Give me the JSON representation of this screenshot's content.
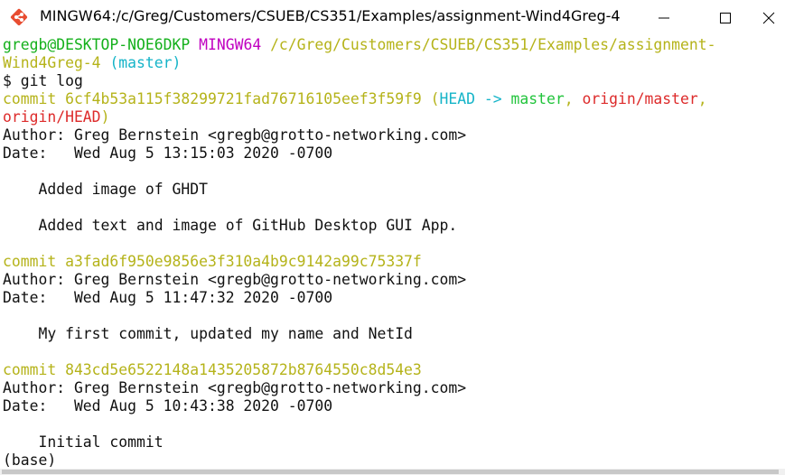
{
  "window": {
    "title": "MINGW64:/c/Greg/Customers/CSUEB/CS351/Examples/assignment-Wind4Greg-4",
    "icon": "git-bash-icon"
  },
  "controls": {
    "minimize": "minimize-icon",
    "maximize": "maximize-icon",
    "close": "close-icon"
  },
  "colors": {
    "green": "#14b01b",
    "magenta": "#c000c0",
    "yellow": "#b5b31a",
    "cyan": "#15b4c8",
    "red": "#dd2b2b",
    "bright_green": "#22c43c",
    "text": "#111111"
  },
  "prompt": {
    "user_host": "gregb@DESKTOP-NOE6DKP",
    "shell": "MINGW64",
    "path_part1": "/c/Greg/Customers/CSUEB/CS351/Examples/assignment-",
    "path_part2": "Wind4Greg-4",
    "branch": "(master)",
    "command": "$ git log"
  },
  "commits": [
    {
      "hash_line": "commit 6cf4b53a115f38299721fad76716105eef3f59f9",
      "refs": {
        "open": "(",
        "head": "HEAD",
        "arrow": " -> ",
        "branch": "master",
        "sep1": ", ",
        "origin_master": "origin/master",
        "sep2": ",",
        "origin_head": "origin/HEAD",
        "close": ")"
      },
      "author": "Author: Greg Bernstein <gregb@grotto-networking.com>",
      "date": "Date:   Wed Aug 5 13:15:03 2020 -0700",
      "messages": [
        "    Added image of GHDT",
        "    Added text and image of GitHub Desktop GUI App."
      ]
    },
    {
      "hash_line": "commit a3fad6f950e9856e3f310a4b9c9142a99c75337f",
      "author": "Author: Greg Bernstein <gregb@grotto-networking.com>",
      "date": "Date:   Wed Aug 5 11:47:32 2020 -0700",
      "messages": [
        "    My first commit, updated my name and NetId"
      ]
    },
    {
      "hash_line": "commit 843cd5e6522148a1435205872b8764550c8d54e3",
      "author": "Author: Greg Bernstein <gregb@grotto-networking.com>",
      "date": "Date:   Wed Aug 5 10:43:38 2020 -0700",
      "messages": [
        "    Initial commit"
      ]
    }
  ],
  "footer": "(base)"
}
